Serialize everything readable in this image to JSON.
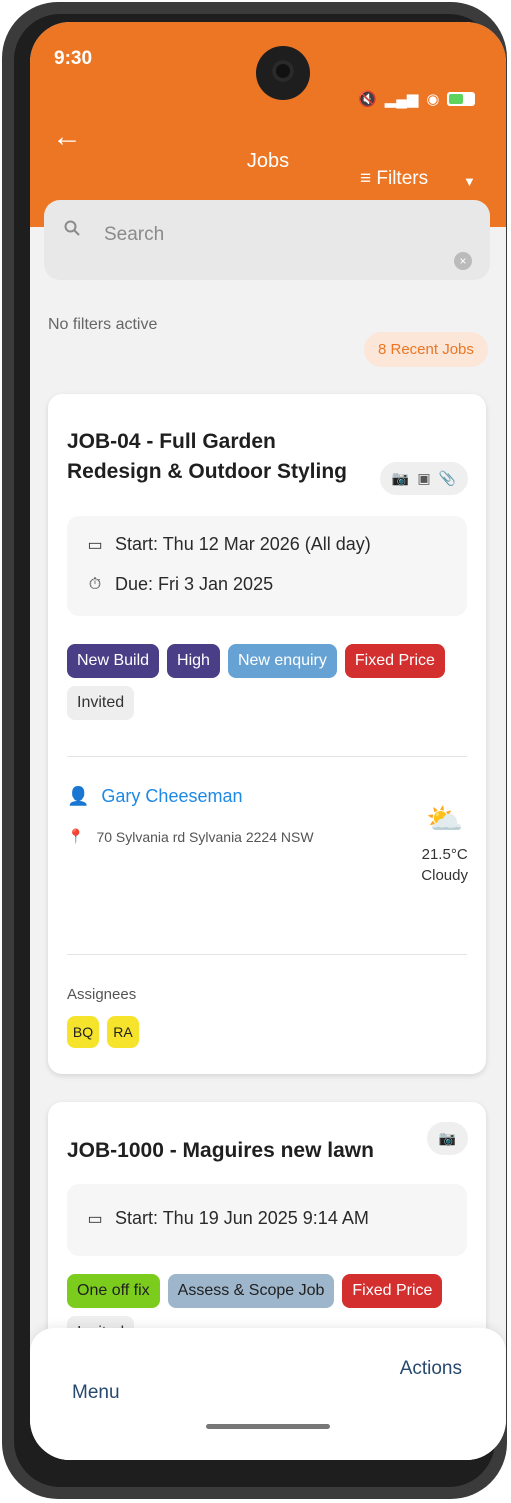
{
  "status_bar": {
    "time": "9:30"
  },
  "header": {
    "title": "Jobs",
    "filters_label": "Filters"
  },
  "search": {
    "placeholder": "Search"
  },
  "filters_note": "No filters active",
  "recent_badge": "8 Recent Jobs",
  "jobs": [
    {
      "title": "JOB-04 - Full Garden Redesign & Outdoor Styling",
      "start": "Start: Thu 12 Mar 2026 (All day)",
      "due": "Due: Fri 3 Jan 2025",
      "tags": [
        "New Build",
        "High",
        "New enquiry",
        "Fixed Price",
        "Invited"
      ],
      "client_name": "Gary Cheeseman",
      "address": "70 Sylvania rd Sylvania 2224 NSW",
      "weather": {
        "temp": "21.5°C",
        "desc": "Cloudy"
      },
      "assignees_label": "Assignees",
      "assignees": [
        "BQ",
        "RA"
      ]
    },
    {
      "title": "JOB-1000 - Maguires new lawn",
      "start": "Start: Thu 19 Jun 2025 9:14 AM",
      "tags": [
        "One off fix",
        "Assess & Scope Job",
        "Fixed Price",
        "Invited"
      ]
    }
  ],
  "bottom_bar": {
    "menu_label": "Menu",
    "actions_label": "Actions"
  },
  "colors": {
    "accent": "#ec7624",
    "link": "#1e88e5",
    "nav": "#27496d"
  }
}
